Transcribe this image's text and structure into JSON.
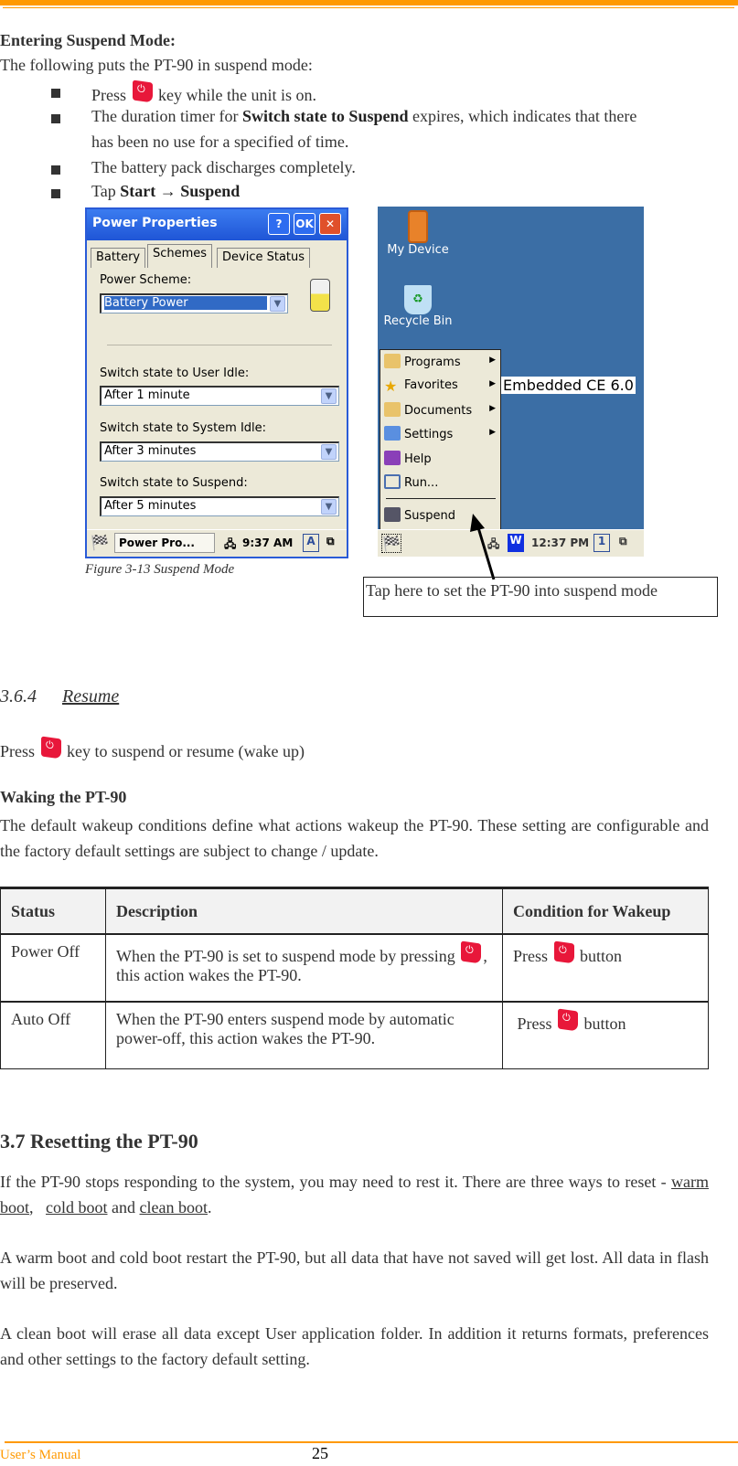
{
  "header": {
    "accent_color": "#ff9900"
  },
  "suspend": {
    "heading": "Entering Suspend Mode:",
    "intro": "The following puts the PT-90 in suspend mode:",
    "bullets": [
      {
        "pre": "Press",
        "post": "key while the unit is on."
      },
      {
        "pre": "The duration timer for",
        "bold": "Switch state to Suspend",
        "post": "expires, which indicates that there",
        "line2": "has been no use for a specified of time."
      },
      {
        "text": "The battery pack discharges completely."
      },
      {
        "pre": "Tap",
        "bold1": "Start",
        "arrow": "→",
        "bold2": "Suspend"
      }
    ]
  },
  "power_window": {
    "title": "Power Properties",
    "help": "?",
    "ok": "OK",
    "close": "✕",
    "tabs": [
      "Battery",
      "Schemes",
      "Device Status"
    ],
    "power_scheme_label": "Power Scheme:",
    "power_scheme_value": "Battery Power",
    "user_idle_label": "Switch state to User Idle:",
    "user_idle_value": "After 1 minute",
    "system_idle_label": "Switch state to System Idle:",
    "system_idle_value": "After 3 minutes",
    "suspend_label": "Switch state to Suspend:",
    "suspend_value": "After 5 minutes",
    "taskbar_app": "Power Pro...",
    "clock": "9:37 AM",
    "input": "A"
  },
  "desktop": {
    "icons": [
      "My Device",
      "Recycle Bin"
    ],
    "wallpaper_text": "Embedded CE 6.0",
    "menu": [
      "Programs",
      "Favorites",
      "Documents",
      "Settings",
      "Help",
      "Run...",
      "Suspend"
    ],
    "clock": "12:37 PM",
    "input": "1"
  },
  "figure_caption": "Figure 3-13 Suspend Mode",
  "callout": "Tap here to set the PT-90 into suspend mode",
  "resume": {
    "number": "3.6.4",
    "title": "Resume",
    "line_pre": "Press",
    "line_post": "key to suspend or resume (wake up)",
    "waking_heading": "Waking the PT-90",
    "waking_text": "The default wakeup conditions define what actions wakeup the PT-90. These setting are configurable and the factory default settings are subject to change / update."
  },
  "table": {
    "headers": [
      "Status",
      "Description",
      "Condition for Wakeup"
    ],
    "rows": [
      {
        "status": "Power Off",
        "desc_pre": "When the PT-90 is set to suspend mode by pressing",
        "desc_post": ", this action wakes the PT-90.",
        "cond_pre": "Press",
        "cond_post": "button"
      },
      {
        "status": "Auto Off",
        "desc": "When the PT-90 enters suspend mode by automatic power-off, this action wakes the PT-90.",
        "cond_pre": "Press",
        "cond_post": "button"
      }
    ]
  },
  "reset": {
    "heading": "3.7  Resetting the PT-90",
    "p1_pre": "If the PT-90 stops responding to the system, you may need to rest it. There are three ways to reset -",
    "link1": "warm boot",
    "sep": ",",
    "link2": "cold boot",
    "and": "and",
    "link3": "clean boot",
    "end": ".",
    "p2": "A warm boot and cold boot restart the PT-90, but all data that have not saved will get lost. All data in flash will be preserved.",
    "p3": "A clean boot will erase all data except User application folder. In addition it returns formats, preferences and other settings to the factory default setting."
  },
  "footer": {
    "label": "User’s Manual",
    "page": "25"
  }
}
